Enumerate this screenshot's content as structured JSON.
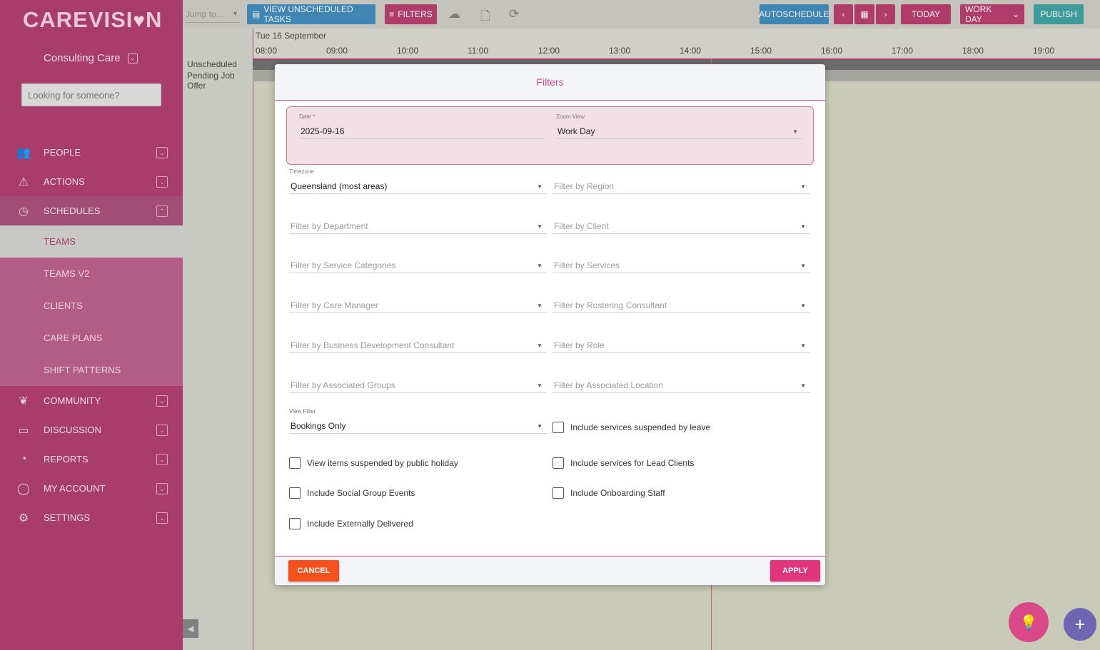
{
  "app": {
    "logo_text_a": "CAREVISI",
    "logo_text_b": "N"
  },
  "sidebar": {
    "org_name": "Consulting Care",
    "search_placeholder": "Looking for someone?",
    "items": [
      {
        "label": "PEOPLE",
        "icon": "people-icon"
      },
      {
        "label": "ACTIONS",
        "icon": "warning-icon"
      },
      {
        "label": "SCHEDULES",
        "icon": "clock-icon"
      },
      {
        "label": "COMMUNITY",
        "icon": "community-icon"
      },
      {
        "label": "DISCUSSION",
        "icon": "chat-icon"
      },
      {
        "label": "REPORTS",
        "icon": "reports-icon"
      },
      {
        "label": "MY ACCOUNT",
        "icon": "user-icon"
      },
      {
        "label": "SETTINGS",
        "icon": "gear-icon"
      }
    ],
    "sub_items": [
      "TEAMS",
      "TEAMS V2",
      "CLIENTS",
      "CARE PLANS",
      "SHIFT PATTERNS"
    ]
  },
  "toolbar": {
    "jump_placeholder": "Jump to...",
    "view_unscheduled": "VIEW UNSCHEDULED TASKS",
    "filters": "FILTERS",
    "autoschedule": "AUTOSCHEDULE",
    "today": "TODAY",
    "work_day": "WORK DAY",
    "publish": "PUBLISH"
  },
  "timeline": {
    "date": "Tue 16 September",
    "hours": [
      "08:00",
      "09:00",
      "10:00",
      "11:00",
      "12:00",
      "13:00",
      "14:00",
      "15:00",
      "16:00",
      "17:00",
      "18:00",
      "19:00"
    ],
    "rows": [
      "Unscheduled",
      "Pending Job Offer"
    ]
  },
  "modal": {
    "title": "Filters",
    "date_label": "Date *",
    "date_value": "2025-09-16",
    "zoom_label": "Zoom View",
    "zoom_value": "Work Day",
    "timezone_label": "Timezone",
    "timezone_value": "Queensland (most areas)",
    "region_ph": "Filter by Region",
    "department_ph": "Filter by Department",
    "client_ph": "Filter by Client",
    "service_categories_ph": "Filter by Service Categories",
    "services_ph": "Filter by Services",
    "care_manager_ph": "Filter by Care Manager",
    "rostering_ph": "Filter by Rostering Consultant",
    "bdc_ph": "Filter by Business Development Consultant",
    "role_ph": "Filter by Role",
    "groups_ph": "Filter by Associated Groups",
    "location_ph": "Filter by Associated Location",
    "view_filter_label": "View Filter",
    "view_filter_value": "Bookings Only",
    "cb_suspended_leave": "Include services suspended by leave",
    "cb_public_holiday": "View items suspended by public holiday",
    "cb_lead_clients": "Include services for Lead Clients",
    "cb_social_group": "Include Social Group Events",
    "cb_onboarding": "Include Onboarding Staff",
    "cb_external": "Include Externally Delivered",
    "cancel": "CANCEL",
    "apply": "APPLY"
  }
}
